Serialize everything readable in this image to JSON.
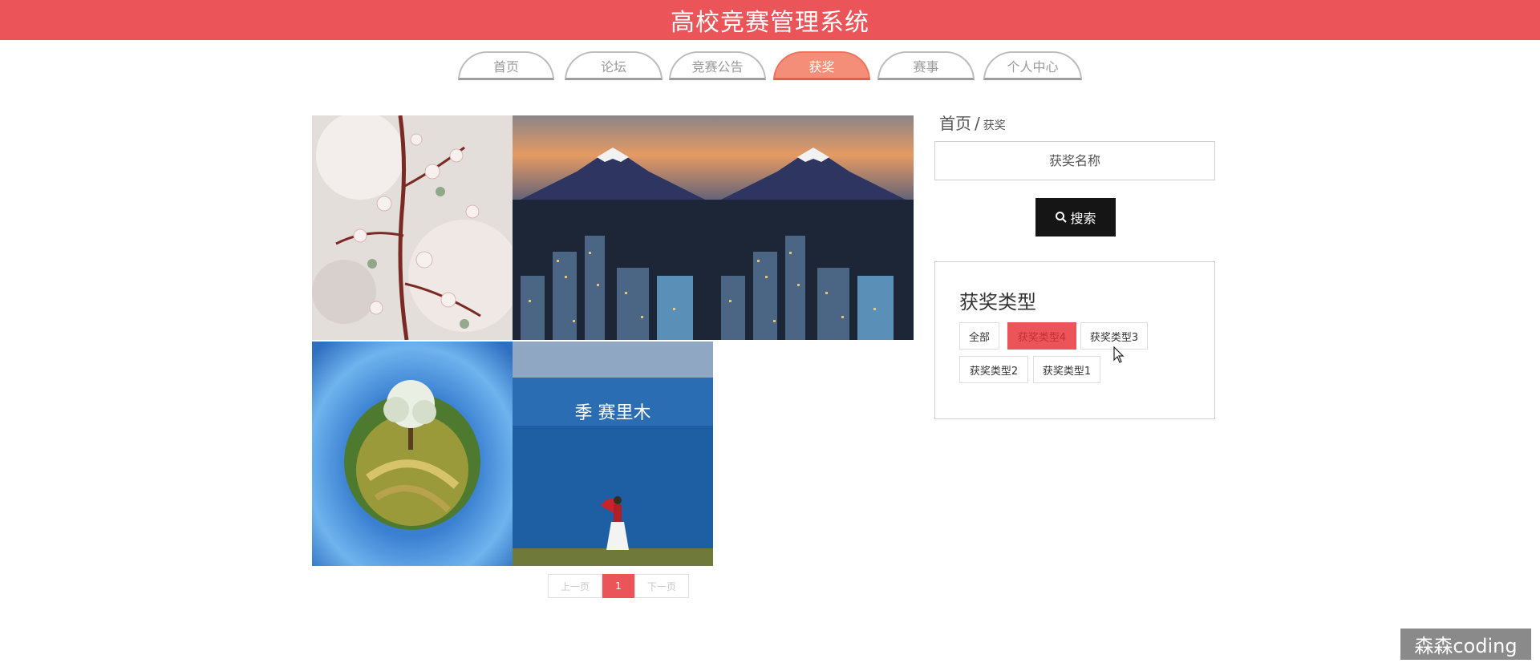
{
  "app": {
    "title": "高校竞赛管理系统"
  },
  "nav": {
    "tabs": [
      {
        "label": "首页",
        "active": false
      },
      {
        "label": "论坛",
        "active": false
      },
      {
        "label": "竞赛公告",
        "active": false
      },
      {
        "label": "获奖",
        "active": true
      },
      {
        "label": "赛事",
        "active": false
      },
      {
        "label": "个人中心",
        "active": false
      }
    ]
  },
  "gallery": {
    "items": [
      {
        "image": "cherry-blossom-photo"
      },
      {
        "image": "mount-fuji-city-photo"
      },
      {
        "image": "mount-fuji-city-photo"
      },
      {
        "image": "tiny-planet-tree-photo"
      },
      {
        "image": "woman-by-lake-photo",
        "overlay_text": "季 赛里木"
      }
    ]
  },
  "pagination": {
    "prev": "上一页",
    "current": "1",
    "next": "下一页"
  },
  "breadcrumb": {
    "home": "首页",
    "separator": "/",
    "current": "获奖"
  },
  "search": {
    "placeholder": "获奖名称",
    "button_label": "搜索",
    "icon": "search-icon"
  },
  "filter": {
    "title": "获奖类型",
    "tags": [
      {
        "label": "全部",
        "active": false
      },
      {
        "label": "获奖类型4",
        "active": true
      },
      {
        "label": "获奖类型3",
        "active": false
      },
      {
        "label": "获奖类型2",
        "active": false
      },
      {
        "label": "获奖类型1",
        "active": false
      }
    ]
  },
  "watermark": {
    "text": "森森coding"
  },
  "colors": {
    "brand": "#eb5459",
    "active_tab": "#f58e78",
    "button_dark": "#151515"
  }
}
